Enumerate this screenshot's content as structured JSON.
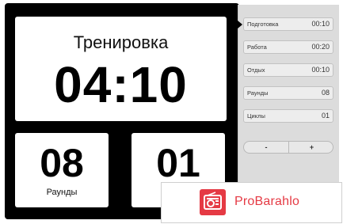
{
  "timer": {
    "title": "Тренировка",
    "time": "04:10"
  },
  "counters": {
    "rounds": {
      "value": "08",
      "label": "Раунды"
    },
    "cycles": {
      "value": "01"
    }
  },
  "settings": [
    {
      "label": "Подготовка",
      "value": "00:10"
    },
    {
      "label": "Работа",
      "value": "00:20"
    },
    {
      "label": "Отдых",
      "value": "00:10"
    },
    {
      "label": "Раунды",
      "value": "08"
    },
    {
      "label": "Циклы",
      "value": "01"
    }
  ],
  "stepper": {
    "minus": "-",
    "plus": "+"
  },
  "watermark": {
    "text": "ProBarahlo"
  },
  "colors": {
    "panel": "#000000",
    "settings_bg": "#dcdcdc",
    "brand": "#e53a44"
  }
}
